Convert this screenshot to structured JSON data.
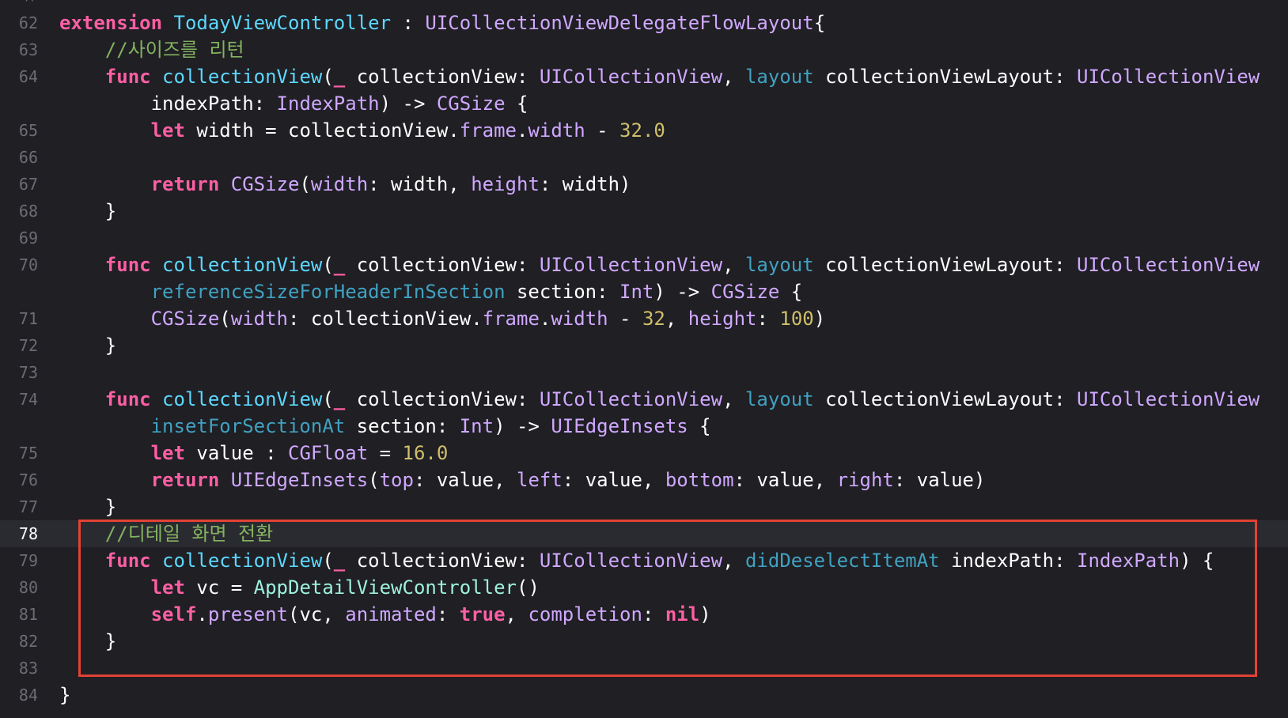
{
  "editor": {
    "current_line": "78",
    "colors": {
      "background": "#1f1f24",
      "current_line_background": "#2a2a31",
      "line_number": "#6c6c74",
      "keyword": "#fc5fa3",
      "type": "#d0a8ff",
      "declaration": "#5dd8ff",
      "identifier": "#41a1c0",
      "comment": "#84b360",
      "number": "#d0bf69",
      "plain": "#ffffff",
      "project_type": "#9ef1dd",
      "highlight_box": "#e34234"
    },
    "lines": [
      {
        "number": "62",
        "tokens": [
          {
            "text": "extension",
            "kind": "keyword"
          },
          {
            "text": " ",
            "kind": "plain"
          },
          {
            "text": "TodayViewController",
            "kind": "decl"
          },
          {
            "text": " : ",
            "kind": "plain"
          },
          {
            "text": "UICollectionViewDelegateFlowLayout",
            "kind": "type"
          },
          {
            "text": "{",
            "kind": "plain"
          }
        ]
      },
      {
        "number": "63",
        "tokens": [
          {
            "text": "    //사이즈를 리턴",
            "kind": "comment"
          }
        ]
      },
      {
        "number": "64",
        "tokens": [
          {
            "text": "    ",
            "kind": "plain"
          },
          {
            "text": "func",
            "kind": "keyword"
          },
          {
            "text": " ",
            "kind": "plain"
          },
          {
            "text": "collectionView",
            "kind": "decl"
          },
          {
            "text": "(",
            "kind": "plain"
          },
          {
            "text": "_",
            "kind": "keyword"
          },
          {
            "text": " collectionView: ",
            "kind": "plain"
          },
          {
            "text": "UICollectionView",
            "kind": "type"
          },
          {
            "text": ", ",
            "kind": "plain"
          },
          {
            "text": "layout",
            "kind": "ident"
          },
          {
            "text": " collectionViewLayout: ",
            "kind": "plain"
          },
          {
            "text": "UICollectionView",
            "kind": "type"
          }
        ]
      },
      {
        "number": "",
        "tokens": [
          {
            "text": "        indexPath: ",
            "kind": "plain"
          },
          {
            "text": "IndexPath",
            "kind": "type"
          },
          {
            "text": ") -> ",
            "kind": "plain"
          },
          {
            "text": "CGSize",
            "kind": "type"
          },
          {
            "text": " {",
            "kind": "plain"
          }
        ]
      },
      {
        "number": "65",
        "tokens": [
          {
            "text": "        ",
            "kind": "plain"
          },
          {
            "text": "let",
            "kind": "keyword"
          },
          {
            "text": " width = collectionView.",
            "kind": "plain"
          },
          {
            "text": "frame",
            "kind": "member"
          },
          {
            "text": ".",
            "kind": "plain"
          },
          {
            "text": "width",
            "kind": "member"
          },
          {
            "text": " - ",
            "kind": "plain"
          },
          {
            "text": "32.0",
            "kind": "number"
          }
        ]
      },
      {
        "number": "66",
        "tokens": []
      },
      {
        "number": "67",
        "tokens": [
          {
            "text": "        ",
            "kind": "plain"
          },
          {
            "text": "return",
            "kind": "keyword"
          },
          {
            "text": " ",
            "kind": "plain"
          },
          {
            "text": "CGSize",
            "kind": "type"
          },
          {
            "text": "(",
            "kind": "plain"
          },
          {
            "text": "width",
            "kind": "member"
          },
          {
            "text": ": width, ",
            "kind": "plain"
          },
          {
            "text": "height",
            "kind": "member"
          },
          {
            "text": ": width)",
            "kind": "plain"
          }
        ]
      },
      {
        "number": "68",
        "tokens": [
          {
            "text": "    }",
            "kind": "plain"
          }
        ]
      },
      {
        "number": "69",
        "tokens": []
      },
      {
        "number": "70",
        "tokens": [
          {
            "text": "    ",
            "kind": "plain"
          },
          {
            "text": "func",
            "kind": "keyword"
          },
          {
            "text": " ",
            "kind": "plain"
          },
          {
            "text": "collectionView",
            "kind": "decl"
          },
          {
            "text": "(",
            "kind": "plain"
          },
          {
            "text": "_",
            "kind": "keyword"
          },
          {
            "text": " collectionView: ",
            "kind": "plain"
          },
          {
            "text": "UICollectionView",
            "kind": "type"
          },
          {
            "text": ", ",
            "kind": "plain"
          },
          {
            "text": "layout",
            "kind": "ident"
          },
          {
            "text": " collectionViewLayout: ",
            "kind": "plain"
          },
          {
            "text": "UICollectionView",
            "kind": "type"
          }
        ]
      },
      {
        "number": "",
        "tokens": [
          {
            "text": "        ",
            "kind": "plain"
          },
          {
            "text": "referenceSizeForHeaderInSection",
            "kind": "ident"
          },
          {
            "text": " section: ",
            "kind": "plain"
          },
          {
            "text": "Int",
            "kind": "type"
          },
          {
            "text": ") -> ",
            "kind": "plain"
          },
          {
            "text": "CGSize",
            "kind": "type"
          },
          {
            "text": " {",
            "kind": "plain"
          }
        ]
      },
      {
        "number": "71",
        "tokens": [
          {
            "text": "        ",
            "kind": "plain"
          },
          {
            "text": "CGSize",
            "kind": "type"
          },
          {
            "text": "(",
            "kind": "plain"
          },
          {
            "text": "width",
            "kind": "member"
          },
          {
            "text": ": collectionView.",
            "kind": "plain"
          },
          {
            "text": "frame",
            "kind": "member"
          },
          {
            "text": ".",
            "kind": "plain"
          },
          {
            "text": "width",
            "kind": "member"
          },
          {
            "text": " - ",
            "kind": "plain"
          },
          {
            "text": "32",
            "kind": "number"
          },
          {
            "text": ", ",
            "kind": "plain"
          },
          {
            "text": "height",
            "kind": "member"
          },
          {
            "text": ": ",
            "kind": "plain"
          },
          {
            "text": "100",
            "kind": "number"
          },
          {
            "text": ")",
            "kind": "plain"
          }
        ]
      },
      {
        "number": "72",
        "tokens": [
          {
            "text": "    }",
            "kind": "plain"
          }
        ]
      },
      {
        "number": "73",
        "tokens": []
      },
      {
        "number": "74",
        "tokens": [
          {
            "text": "    ",
            "kind": "plain"
          },
          {
            "text": "func",
            "kind": "keyword"
          },
          {
            "text": " ",
            "kind": "plain"
          },
          {
            "text": "collectionView",
            "kind": "decl"
          },
          {
            "text": "(",
            "kind": "plain"
          },
          {
            "text": "_",
            "kind": "keyword"
          },
          {
            "text": " collectionView: ",
            "kind": "plain"
          },
          {
            "text": "UICollectionView",
            "kind": "type"
          },
          {
            "text": ", ",
            "kind": "plain"
          },
          {
            "text": "layout",
            "kind": "ident"
          },
          {
            "text": " collectionViewLayout: ",
            "kind": "plain"
          },
          {
            "text": "UICollectionView",
            "kind": "type"
          }
        ]
      },
      {
        "number": "",
        "tokens": [
          {
            "text": "        ",
            "kind": "plain"
          },
          {
            "text": "insetForSectionAt",
            "kind": "ident"
          },
          {
            "text": " section: ",
            "kind": "plain"
          },
          {
            "text": "Int",
            "kind": "type"
          },
          {
            "text": ") -> ",
            "kind": "plain"
          },
          {
            "text": "UIEdgeInsets",
            "kind": "type"
          },
          {
            "text": " {",
            "kind": "plain"
          }
        ]
      },
      {
        "number": "75",
        "tokens": [
          {
            "text": "        ",
            "kind": "plain"
          },
          {
            "text": "let",
            "kind": "keyword"
          },
          {
            "text": " value : ",
            "kind": "plain"
          },
          {
            "text": "CGFloat",
            "kind": "type"
          },
          {
            "text": " = ",
            "kind": "plain"
          },
          {
            "text": "16.0",
            "kind": "number"
          }
        ]
      },
      {
        "number": "76",
        "tokens": [
          {
            "text": "        ",
            "kind": "plain"
          },
          {
            "text": "return",
            "kind": "keyword"
          },
          {
            "text": " ",
            "kind": "plain"
          },
          {
            "text": "UIEdgeInsets",
            "kind": "type"
          },
          {
            "text": "(",
            "kind": "plain"
          },
          {
            "text": "top",
            "kind": "member"
          },
          {
            "text": ": value, ",
            "kind": "plain"
          },
          {
            "text": "left",
            "kind": "member"
          },
          {
            "text": ": value, ",
            "kind": "plain"
          },
          {
            "text": "bottom",
            "kind": "member"
          },
          {
            "text": ": value, ",
            "kind": "plain"
          },
          {
            "text": "right",
            "kind": "member"
          },
          {
            "text": ": value)",
            "kind": "plain"
          }
        ]
      },
      {
        "number": "77",
        "tokens": [
          {
            "text": "    }",
            "kind": "plain"
          }
        ]
      },
      {
        "number": "78",
        "tokens": [
          {
            "text": "    //디테일 화면 전환",
            "kind": "comment"
          }
        ]
      },
      {
        "number": "79",
        "tokens": [
          {
            "text": "    ",
            "kind": "plain"
          },
          {
            "text": "func",
            "kind": "keyword"
          },
          {
            "text": " ",
            "kind": "plain"
          },
          {
            "text": "collectionView",
            "kind": "decl"
          },
          {
            "text": "(",
            "kind": "plain"
          },
          {
            "text": "_",
            "kind": "keyword"
          },
          {
            "text": " collectionView: ",
            "kind": "plain"
          },
          {
            "text": "UICollectionView",
            "kind": "type"
          },
          {
            "text": ", ",
            "kind": "plain"
          },
          {
            "text": "didDeselectItemAt",
            "kind": "ident"
          },
          {
            "text": " indexPath: ",
            "kind": "plain"
          },
          {
            "text": "IndexPath",
            "kind": "type"
          },
          {
            "text": ") {",
            "kind": "plain"
          }
        ]
      },
      {
        "number": "80",
        "tokens": [
          {
            "text": "        ",
            "kind": "plain"
          },
          {
            "text": "let",
            "kind": "keyword"
          },
          {
            "text": " vc = ",
            "kind": "plain"
          },
          {
            "text": "AppDetailViewController",
            "kind": "projtype"
          },
          {
            "text": "()",
            "kind": "plain"
          }
        ]
      },
      {
        "number": "81",
        "tokens": [
          {
            "text": "        ",
            "kind": "plain"
          },
          {
            "text": "self",
            "kind": "keyword"
          },
          {
            "text": ".",
            "kind": "plain"
          },
          {
            "text": "present",
            "kind": "member"
          },
          {
            "text": "(vc, ",
            "kind": "plain"
          },
          {
            "text": "animated",
            "kind": "member"
          },
          {
            "text": ": ",
            "kind": "plain"
          },
          {
            "text": "true",
            "kind": "keyword"
          },
          {
            "text": ", ",
            "kind": "plain"
          },
          {
            "text": "completion",
            "kind": "member"
          },
          {
            "text": ": ",
            "kind": "plain"
          },
          {
            "text": "nil",
            "kind": "keyword"
          },
          {
            "text": ")",
            "kind": "plain"
          }
        ]
      },
      {
        "number": "82",
        "tokens": [
          {
            "text": "    }",
            "kind": "plain"
          }
        ]
      },
      {
        "number": "83",
        "tokens": []
      },
      {
        "number": "84",
        "tokens": [
          {
            "text": "}",
            "kind": "plain"
          }
        ]
      }
    ]
  }
}
